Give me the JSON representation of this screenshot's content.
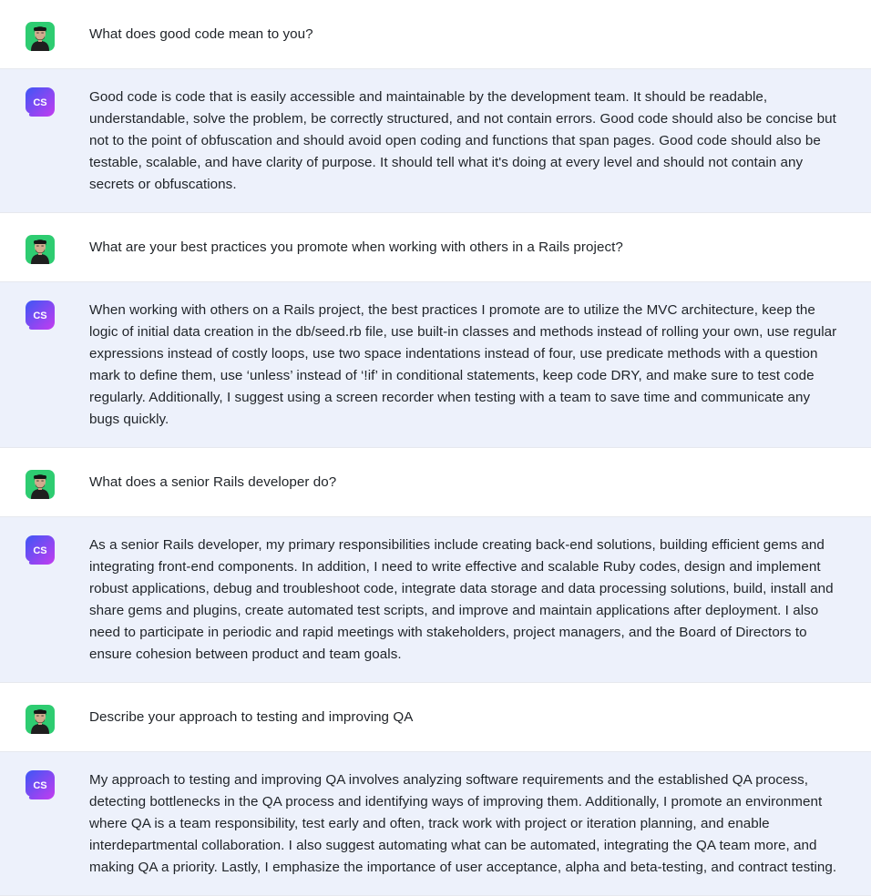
{
  "colors": {
    "user_row_bg": "#ffffff",
    "bot_row_bg": "#edf1fb",
    "user_avatar_bg": "#2ecc71",
    "bot_avatar_gradient_start": "#3d57f5",
    "bot_avatar_gradient_end": "#c43cf0",
    "text": "#1f2328"
  },
  "avatars": {
    "user_icon": "user-avatar-photo",
    "bot_label": "CS"
  },
  "messages": [
    {
      "role": "user",
      "text": "What does good code mean to you?"
    },
    {
      "role": "assistant",
      "text": "Good code is code that is easily accessible and maintainable by the development team. It should be readable, understandable, solve the problem, be correctly structured, and not contain errors. Good code should also be concise but not to the point of obfuscation and should avoid open coding and functions that span pages. Good code should also be testable, scalable, and have clarity of purpose. It should tell what it's doing at every level and should not contain any secrets or obfuscations."
    },
    {
      "role": "user",
      "text": "What are your best practices you promote when working with others in a Rails project?"
    },
    {
      "role": "assistant",
      "text": "When working with others on a Rails project, the best practices I promote are to utilize the MVC architecture, keep the logic of initial data creation in the db/seed.rb file, use built-in classes and methods instead of rolling your own, use regular expressions instead of costly loops, use two space indentations instead of four, use predicate methods with a question mark to define them, use ‘unless’ instead of ‘!if’ in conditional statements, keep code DRY, and make sure to test code regularly. Additionally, I suggest using a screen recorder when testing with a team to save time and communicate any bugs quickly."
    },
    {
      "role": "user",
      "text": "What does a senior Rails developer do?"
    },
    {
      "role": "assistant",
      "text": "As a senior Rails developer, my primary responsibilities include creating back-end solutions, building efficient gems and integrating front-end components. In addition, I need to write effective and scalable Ruby codes, design and implement robust applications, debug and troubleshoot code, integrate data storage and data processing solutions, build, install and share gems and plugins, create automated test scripts, and improve and maintain applications after deployment. I also need to participate in periodic and rapid meetings with stakeholders, project managers, and the Board of Directors to ensure cohesion between product and team goals."
    },
    {
      "role": "user",
      "text": "Describe your approach to testing and improving QA"
    },
    {
      "role": "assistant",
      "text": "My approach to testing and improving QA involves analyzing software requirements and the established QA process, detecting bottlenecks in the QA process and identifying ways of improving them. Additionally, I promote an environment where QA is a team responsibility, test early and often, track work with project or iteration planning, and enable interdepartmental collaboration. I also suggest automating what can be automated, integrating the QA team more, and making QA a priority. Lastly, I emphasize the importance of user acceptance, alpha and beta-testing, and contract testing."
    }
  ]
}
